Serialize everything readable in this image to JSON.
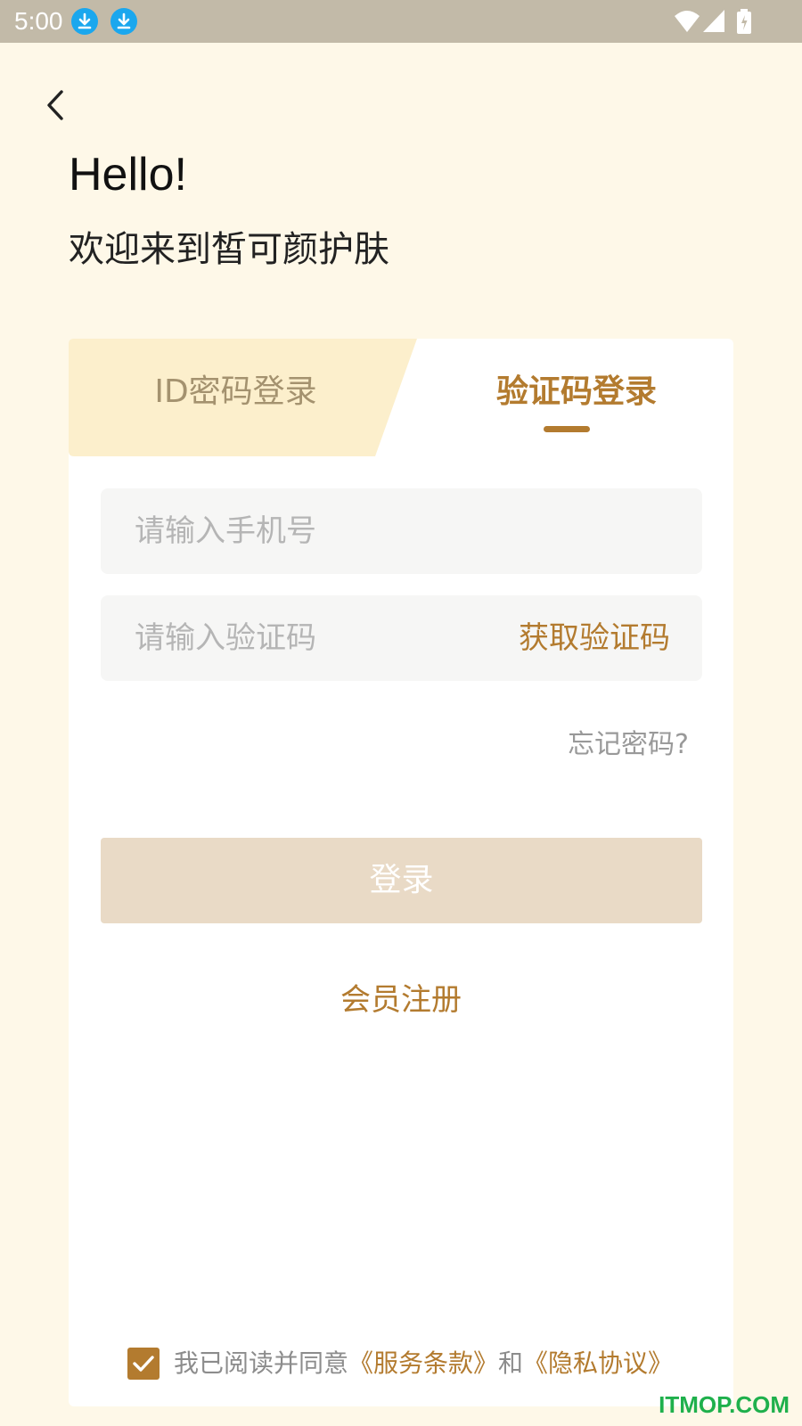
{
  "status_bar": {
    "time": "5:00",
    "icons": [
      "download-icon",
      "download-icon",
      "wifi-icon",
      "signal-icon",
      "battery-charging-icon"
    ]
  },
  "header": {
    "back_icon": "chevron-left-icon",
    "greeting": "Hello!",
    "welcome": "欢迎来到皙可颜护肤"
  },
  "tabs": [
    {
      "label": "ID密码登录",
      "active": false
    },
    {
      "label": "验证码登录",
      "active": true
    }
  ],
  "form": {
    "phone_placeholder": "请输入手机号",
    "code_placeholder": "请输入验证码",
    "get_code_label": "获取验证码",
    "forgot_label": "忘记密码?",
    "login_label": "登录",
    "register_label": "会员注册"
  },
  "agreement": {
    "checked": true,
    "prefix": "我已阅读并同意",
    "terms_label": "《服务条款》",
    "conjunction": "和",
    "privacy_label": "《隐私协议》"
  },
  "watermark": "ITMOP.COM",
  "colors": {
    "accent": "#b37b2f",
    "page_background": "#fef8e8",
    "inactive_tab": "#fcefcc",
    "login_button": "#e9dac6",
    "input_background": "#f6f6f5",
    "status_bar": "#c2baa8"
  }
}
